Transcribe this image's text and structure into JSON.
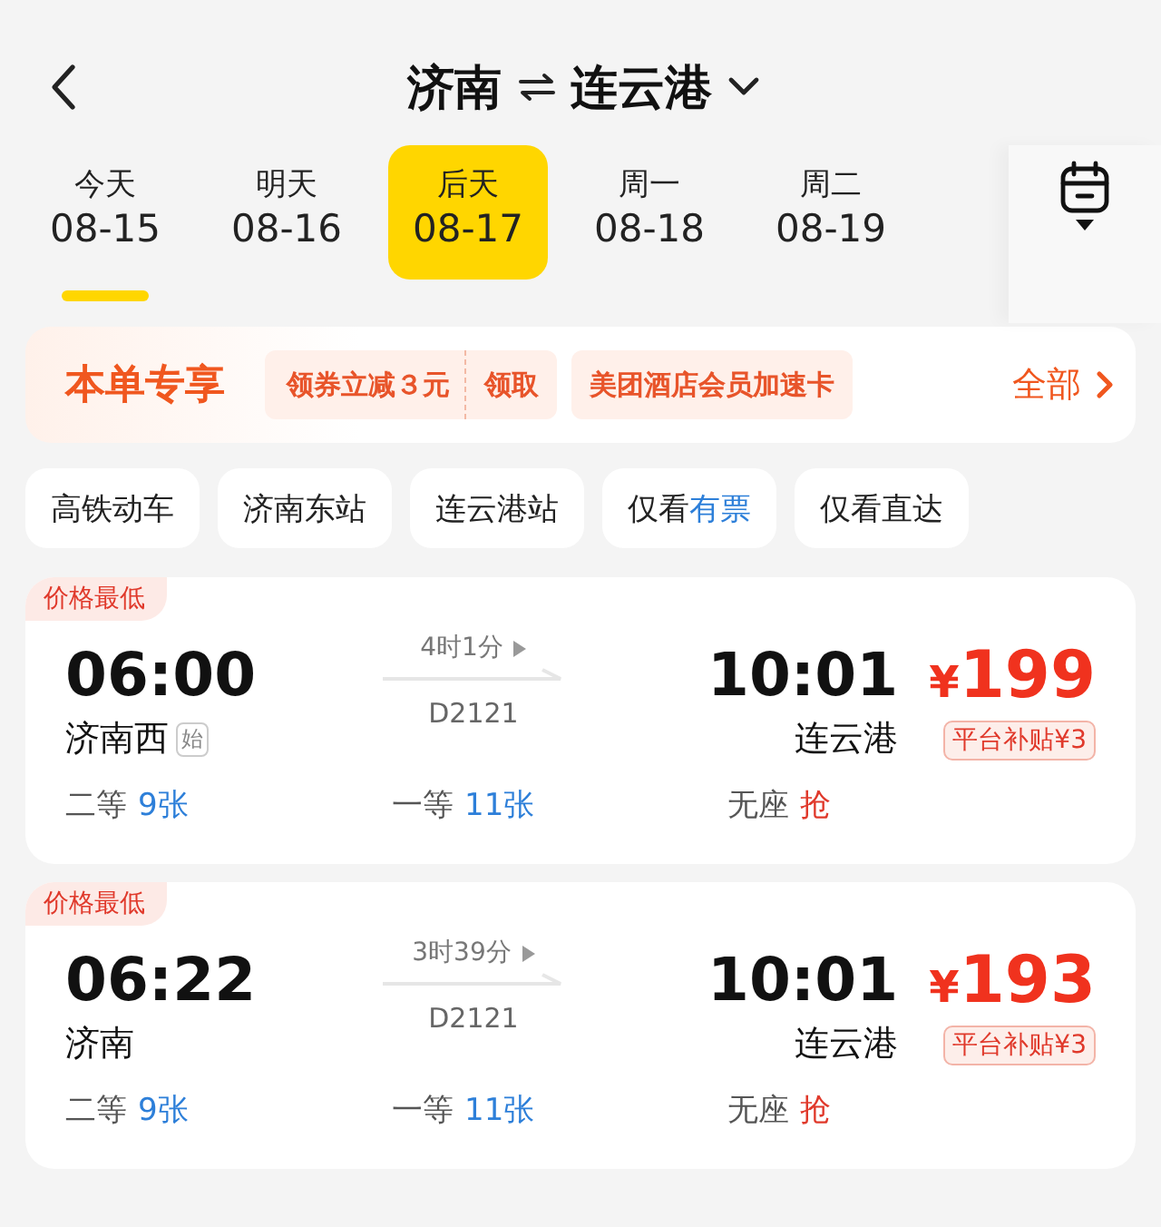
{
  "header": {
    "origin": "济南",
    "destination": "连云港"
  },
  "dates": [
    {
      "day": "今天",
      "date": "08-15",
      "selected": false,
      "underlined": true
    },
    {
      "day": "明天",
      "date": "08-16",
      "selected": false,
      "underlined": false
    },
    {
      "day": "后天",
      "date": "08-17",
      "selected": true,
      "underlined": false
    },
    {
      "day": "周一",
      "date": "08-18",
      "selected": false,
      "underlined": false
    },
    {
      "day": "周二",
      "date": "08-19",
      "selected": false,
      "underlined": false
    }
  ],
  "promo": {
    "title": "本单专享",
    "coupon": "领券立减３元",
    "claim": "领取",
    "card": "美团酒店会员加速卡",
    "all": "全部"
  },
  "filters": [
    {
      "label": "高铁动车"
    },
    {
      "label": "济南东站"
    },
    {
      "label": "连云港站"
    },
    {
      "label": "仅看",
      "highlight": "有票"
    },
    {
      "label": "仅看直达"
    }
  ],
  "trains": [
    {
      "tag": "价格最低",
      "depart": "06:00",
      "from": "济南西",
      "origin_mark": "始",
      "duration": "4时1分",
      "number": "D2121",
      "arrive": "10:01",
      "to": "连云港",
      "currency": "¥",
      "price": "199",
      "subsidy": "平台补贴¥3",
      "seats": [
        {
          "class": "二等",
          "count": "9张",
          "kind": "available"
        },
        {
          "class": "一等",
          "count": "11张",
          "kind": "available"
        },
        {
          "class": "无座",
          "count": "抢",
          "kind": "grab"
        }
      ]
    },
    {
      "tag": "价格最低",
      "depart": "06:22",
      "from": "济南",
      "duration": "3时39分",
      "number": "D2121",
      "arrive": "10:01",
      "to": "连云港",
      "currency": "¥",
      "price": "193",
      "subsidy": "平台补贴¥3",
      "seats": [
        {
          "class": "二等",
          "count": "9张",
          "kind": "available"
        },
        {
          "class": "一等",
          "count": "11张",
          "kind": "available"
        },
        {
          "class": "无座",
          "count": "抢",
          "kind": "grab"
        }
      ]
    }
  ]
}
